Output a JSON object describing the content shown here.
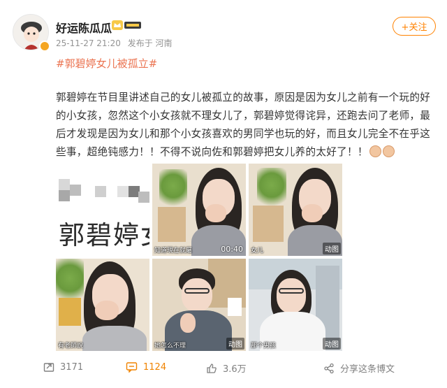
{
  "post": {
    "username": "好运陈瓜瓜",
    "timestamp": "25-11-27 21:20",
    "source": "发布于 河南",
    "follow_label": "+关注",
    "topic": "#郭碧婷女儿被孤立#",
    "body": "郭碧婷在节目里讲述自己的女儿被孤立的故事，原因是因为女儿之前有一个玩的好的小女孩，忽然这个小女孩就不理女儿了，郭碧婷觉得诧异，还跑去问了老师，最后才发现是因为女儿和那个小女孩喜欢的男同学也玩的好，而且女儿完全不在乎这些事，超绝钝感力！！不得不说向佐和郭碧婷把女儿养的太好了！！"
  },
  "media": {
    "title_card_text": "郭碧婷女儿",
    "captions": [
      "知道現在就屬",
      "女儿",
      "",
      "有老師說",
      "她怎么不理",
      "那个男孩"
    ],
    "badge_dynamic": "动图",
    "video_time": "00:40"
  },
  "footer": {
    "reposts": "3171",
    "comments": "1124",
    "likes": "3.6万",
    "share_label": "分享这条博文"
  },
  "colors": {
    "accent": "#ff8200",
    "topic": "#eb7350",
    "muted": "#939393"
  }
}
